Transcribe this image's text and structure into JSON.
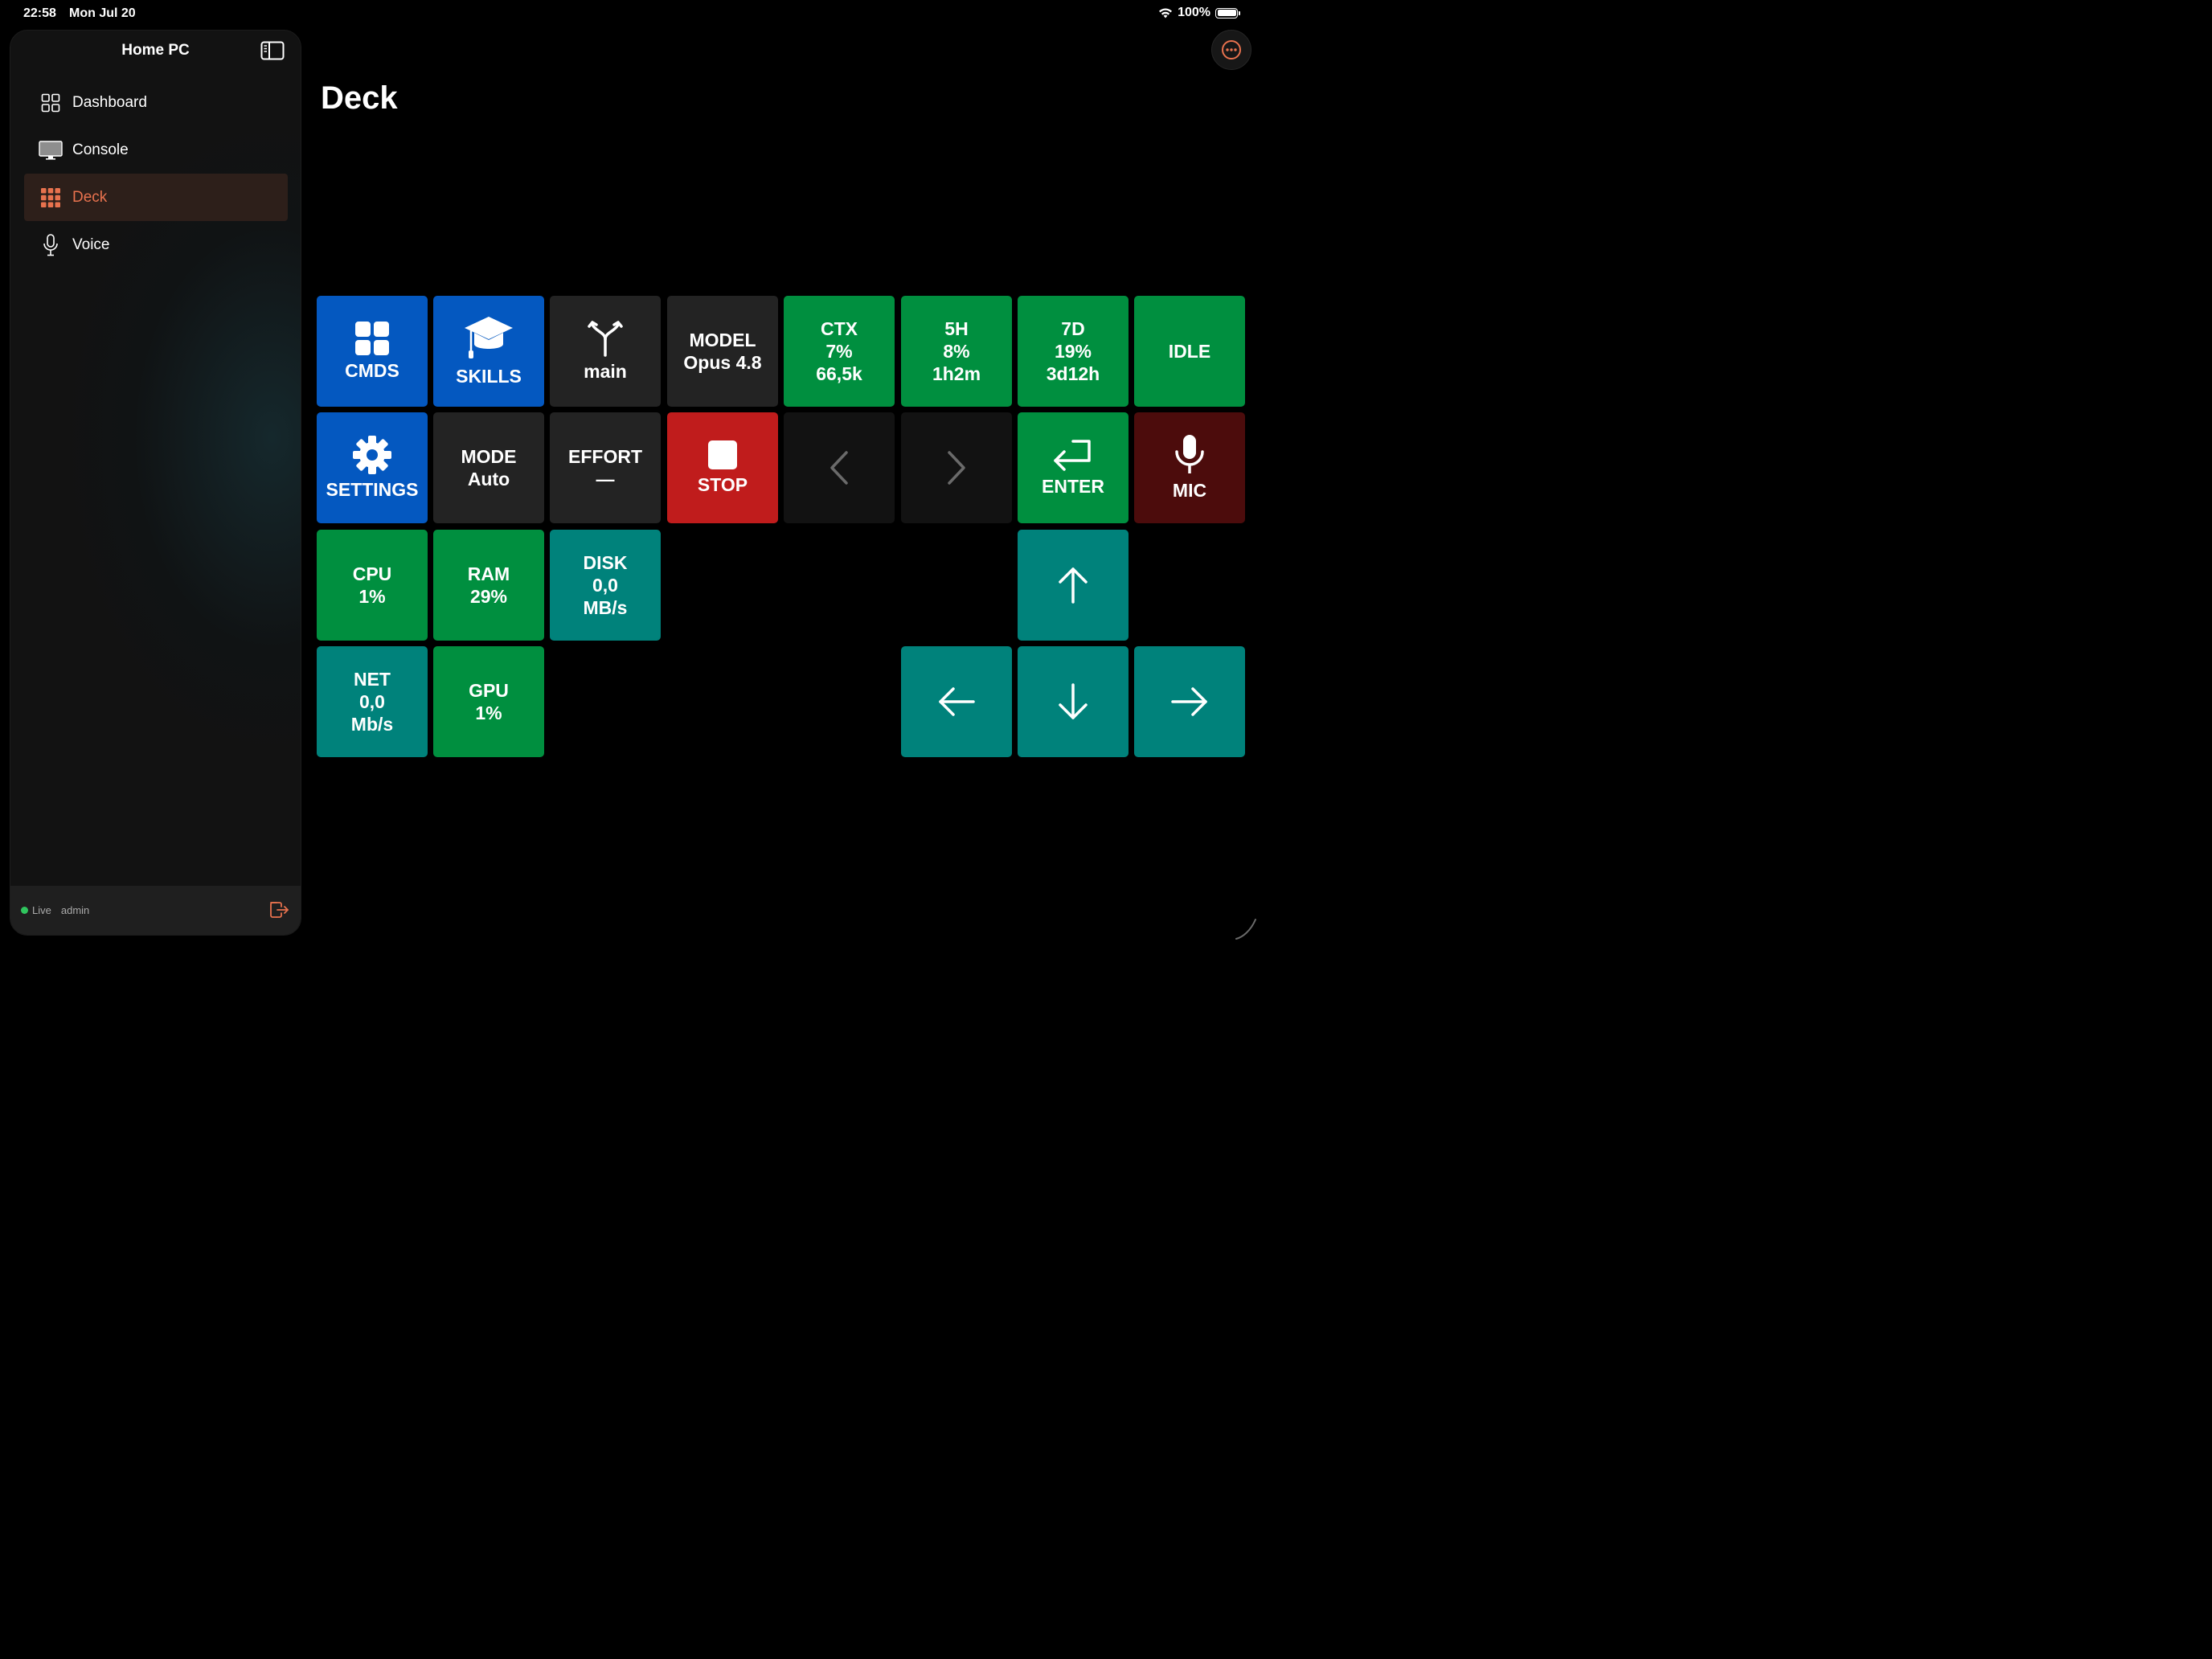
{
  "status_bar": {
    "time": "22:58",
    "date": "Mon Jul 20",
    "battery": "100%"
  },
  "sidebar": {
    "title": "Home PC",
    "items": [
      {
        "label": "Dashboard",
        "icon": "grid-icon",
        "active": false
      },
      {
        "label": "Console",
        "icon": "monitor-icon",
        "active": false
      },
      {
        "label": "Deck",
        "icon": "dots-grid-icon",
        "active": true
      },
      {
        "label": "Voice",
        "icon": "microphone-icon",
        "active": false
      }
    ],
    "footer": {
      "status": "Live",
      "user": "admin"
    }
  },
  "page": {
    "title": "Deck"
  },
  "deck": {
    "cmds": "CMDS",
    "skills": "SKILLS",
    "branch": "main",
    "model": "MODEL\nOpus 4.8",
    "ctx": "CTX\n7%\n66,5k",
    "five_h": "5H\n8%\n1h2m",
    "seven_d": "7D\n19%\n3d12h",
    "idle": "IDLE",
    "settings": "SETTINGS",
    "mode": "MODE\nAuto",
    "effort": "EFFORT\n—",
    "stop": "STOP",
    "enter": "ENTER",
    "mic": "MIC",
    "cpu": "CPU\n1%",
    "ram": "RAM\n29%",
    "disk": "DISK\n0,0\nMB/s",
    "net": "NET\n0,0\nMb/s",
    "gpu": "GPU\n1%"
  },
  "colors": {
    "blue": "#0458c0",
    "green": "#008f3f",
    "teal": "#00827b",
    "red": "#c01c1c",
    "maroon": "#4c0c0c",
    "gray": "#232323",
    "accent": "#e8724e"
  }
}
